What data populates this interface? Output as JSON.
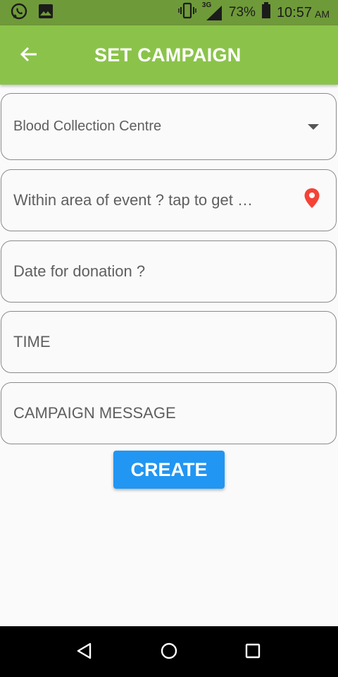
{
  "status_bar": {
    "network": "3G",
    "battery": "73%",
    "time": "10:57",
    "ampm": "AM",
    "icons": [
      "whatsapp-icon",
      "gallery-icon",
      "vibrate-icon",
      "signal-icon",
      "battery-icon"
    ]
  },
  "app_bar": {
    "title": "SET CAMPAIGN",
    "back_icon": "arrow-back-icon"
  },
  "form": {
    "centre_select": {
      "value": "Blood Collection Centre",
      "icon": "dropdown-caret-icon"
    },
    "area_field": {
      "placeholder": "Within area of event ? tap to get …",
      "icon": "location-pin-icon"
    },
    "date_field": {
      "placeholder": "Date for donation ?"
    },
    "time_field": {
      "placeholder": "TIME"
    },
    "message_field": {
      "placeholder": "CAMPAIGN MESSAGE"
    },
    "create_label": "CREATE"
  },
  "colors": {
    "status_bar": "#6f9a39",
    "app_bar": "#8bc34a",
    "button": "#2196f3",
    "pin": "#f44336",
    "background": "#fafafa"
  },
  "nav_bar": {
    "icons": [
      "back-triangle-icon",
      "home-circle-icon",
      "recents-square-icon"
    ]
  }
}
